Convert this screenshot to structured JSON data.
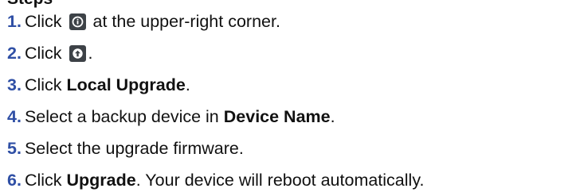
{
  "heading": "Steps",
  "steps": [
    {
      "num": "1.",
      "pre": "Click",
      "icon": "info-icon",
      "post": "at the upper-right corner."
    },
    {
      "num": "2.",
      "pre": "Click",
      "icon": "upgrade-icon",
      "post": "."
    },
    {
      "num": "3.",
      "pre": "Click",
      "bold": "Local Upgrade",
      "post": "."
    },
    {
      "num": "4.",
      "pre": "Select a backup device in",
      "bold": "Device Name",
      "post": "."
    },
    {
      "num": "5.",
      "text": "Select the upgrade firmware."
    },
    {
      "num": "6.",
      "pre": "Click",
      "bold": "Upgrade",
      "post": ". Your device will reboot automatically."
    }
  ],
  "colors": {
    "number": "#2f4fa5",
    "text": "#111111",
    "icon_bg": "#3d4247"
  }
}
